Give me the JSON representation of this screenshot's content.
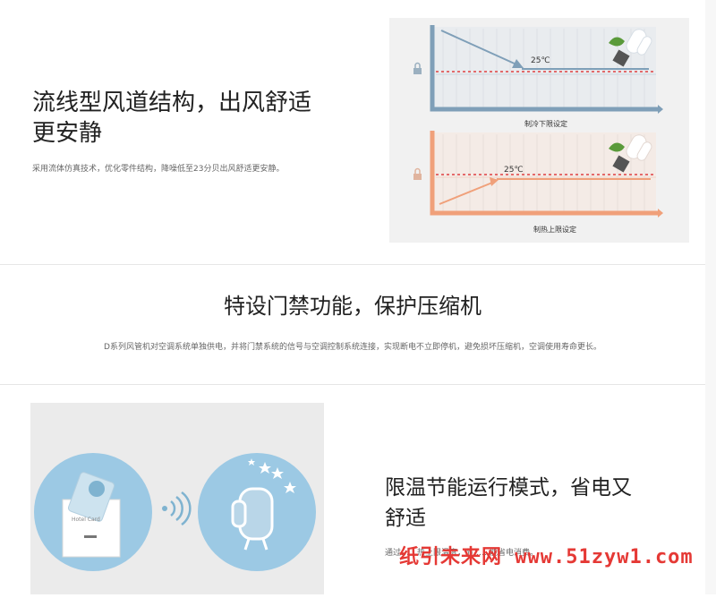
{
  "section1": {
    "title_line1": "流线型风道结构，出风舒适",
    "title_line2": "更安静",
    "description": "采用流体仿真技术，优化零件结构，降噪低至23分贝出风舒适更安静。",
    "cooling_chart": {
      "temp_label": "25℃",
      "caption": "制冷下限设定",
      "line_color": "#7f9fb8",
      "threshold_color": "#e04040"
    },
    "heating_chart": {
      "temp_label": "25℃",
      "caption": "制热上限设定",
      "line_color": "#f0a07a",
      "threshold_color": "#e04040"
    }
  },
  "section2": {
    "title": "特设门禁功能，保护压缩机",
    "description": "D系列风管机对空调系统单独供电，并将门禁系统的信号与空调控制系统连接，实现断电不立即停机，避免损坏压缩机，空调使用寿命更长。"
  },
  "section3": {
    "title_line1": "限温节能运行模式，省电又",
    "title_line2": "舒适",
    "description": "通过……热上限温度，节……能省电消费。",
    "card_label": "Hotel Card"
  },
  "watermark": "纸引未来网 www.51zyw1.com",
  "colors": {
    "circle": "#9cc9e4",
    "accent_green": "#5a9a3a"
  }
}
